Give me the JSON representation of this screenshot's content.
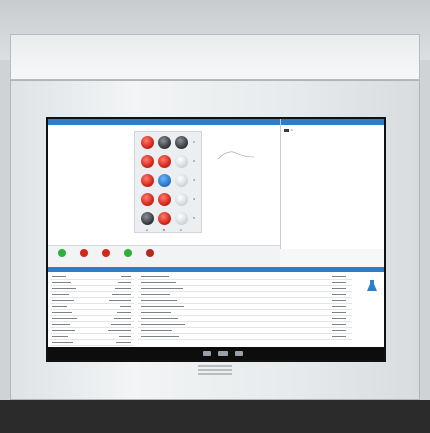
{
  "app": {
    "title": "",
    "colors": {
      "accent": "#2d7dc9",
      "red": "#d5261c",
      "green": "#2fae3a",
      "blue": "#1d6fc8"
    }
  },
  "viewer": {
    "rows": [
      {
        "wells": [
          "red",
          "dark",
          "dark"
        ],
        "label": "1"
      },
      {
        "wells": [
          "red",
          "red",
          "light"
        ],
        "label": "2"
      },
      {
        "wells": [
          "red",
          "blue",
          "light"
        ],
        "label": "3"
      },
      {
        "wells": [
          "red",
          "red",
          "light"
        ],
        "label": "4"
      },
      {
        "wells": [
          "dark",
          "red",
          "light"
        ],
        "label": "5"
      }
    ],
    "col_labels": [
      "A",
      "B",
      "C"
    ]
  },
  "right_panel": {
    "item": "1"
  },
  "toolbar": {
    "buttons": [
      {
        "label": "",
        "color": "#2fae3a",
        "icon": "play-icon"
      },
      {
        "label": "",
        "color": "#d5261c",
        "icon": "stop-icon"
      },
      {
        "label": "",
        "color": "#d5261c",
        "icon": "record-icon"
      },
      {
        "label": "",
        "color": "#2fae3a",
        "icon": "refresh-icon"
      },
      {
        "label": "",
        "color": "#b32a1f",
        "icon": "settings-icon"
      }
    ]
  },
  "bottom": {
    "properties": [
      {
        "k": "",
        "v": ""
      },
      {
        "k": "",
        "v": ""
      },
      {
        "k": "",
        "v": ""
      },
      {
        "k": "",
        "v": ""
      },
      {
        "k": "",
        "v": ""
      },
      {
        "k": "",
        "v": ""
      },
      {
        "k": "",
        "v": ""
      },
      {
        "k": "",
        "v": ""
      },
      {
        "k": "",
        "v": ""
      },
      {
        "k": "",
        "v": ""
      },
      {
        "k": "",
        "v": ""
      },
      {
        "k": "",
        "v": ""
      }
    ],
    "rows": [
      {
        "n": "",
        "r": ""
      },
      {
        "n": "",
        "r": ""
      },
      {
        "n": "",
        "r": ""
      },
      {
        "n": "",
        "r": ""
      },
      {
        "n": "",
        "r": ""
      },
      {
        "n": "",
        "r": ""
      },
      {
        "n": "",
        "r": ""
      },
      {
        "n": "",
        "r": ""
      },
      {
        "n": "",
        "r": ""
      },
      {
        "n": "",
        "r": ""
      },
      {
        "n": "",
        "r": ""
      }
    ]
  }
}
